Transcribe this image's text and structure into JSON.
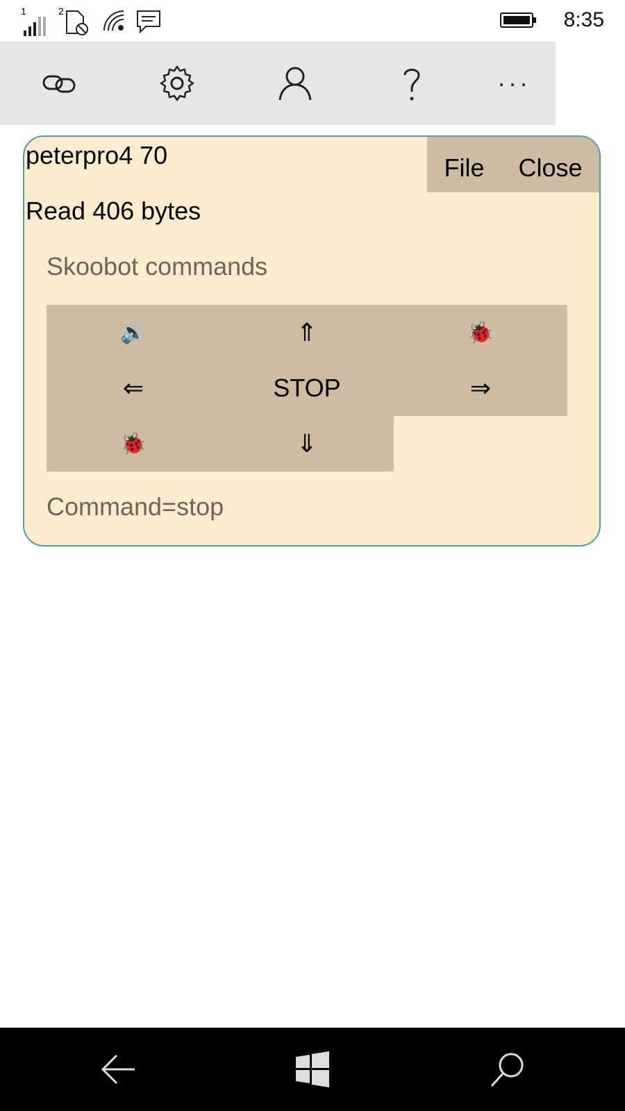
{
  "status_bar": {
    "sim1_label": "1",
    "sim2_label": "2",
    "time": "8:35"
  },
  "app_bar": {
    "buttons": [
      {
        "icon": "link-icon"
      },
      {
        "icon": "gear-icon"
      },
      {
        "icon": "person-icon"
      },
      {
        "icon": "help-icon",
        "label": "?"
      },
      {
        "icon": "more-icon",
        "label": "···"
      }
    ]
  },
  "card": {
    "title": "peterpro4 70",
    "menu": {
      "file": "File",
      "close": "Close"
    },
    "read_status": "Read 406 bytes",
    "section_label": "Skoobot commands",
    "commands": {
      "sound": "🔊",
      "forward": "⇑",
      "bug_right": "🐞",
      "left": "⇐",
      "stop": "STOP",
      "right": "⇒",
      "bug_left": "🐞",
      "backward": "⇓"
    },
    "command_status": "Command=stop"
  },
  "colors": {
    "card_bg": "#fdebcf",
    "card_border": "#5a9a98",
    "button_bg": "#ccbca4",
    "muted_text": "#6d655a",
    "appbar_bg": "#e6e6e6",
    "navbar_bg": "#000000"
  }
}
